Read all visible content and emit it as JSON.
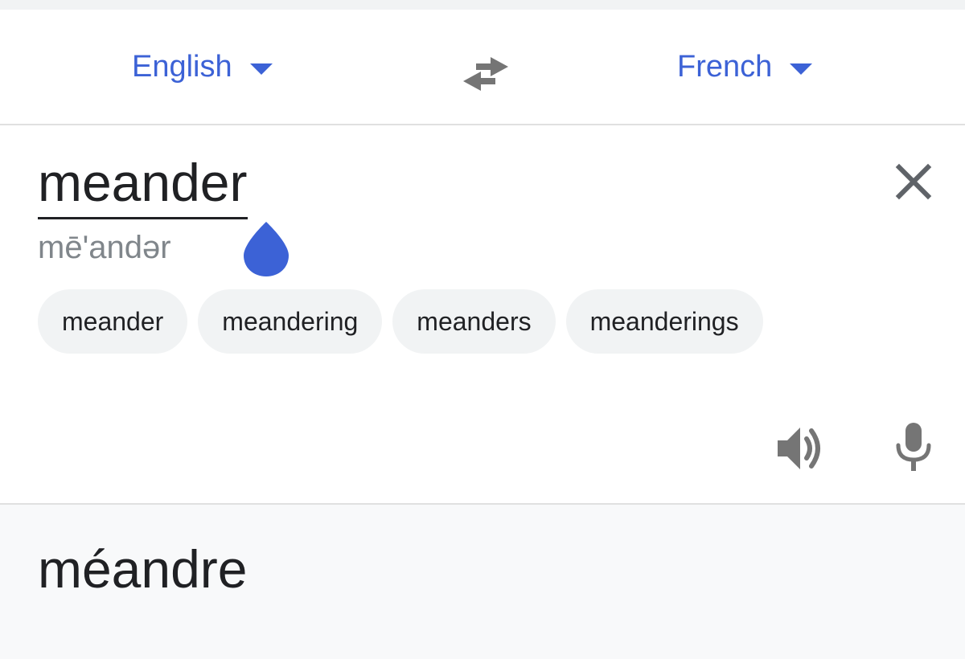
{
  "language_bar": {
    "source_language": "English",
    "target_language": "French",
    "swap_icon": "swap-arrows-icon"
  },
  "input": {
    "text": "meander",
    "phonetic": "mē'andər",
    "clear_icon": "close-icon",
    "suggestions": [
      "meander",
      "meandering",
      "meanders",
      "meanderings"
    ],
    "speaker_icon": "speaker-icon",
    "mic_icon": "microphone-icon"
  },
  "output": {
    "text": "méandre"
  },
  "colors": {
    "accent": "#3c62d6",
    "icon_gray": "#757575",
    "text": "#202124",
    "phonetic_gray": "#80868b",
    "chip_bg": "#f1f3f4",
    "output_bg": "#f8f9fa"
  }
}
